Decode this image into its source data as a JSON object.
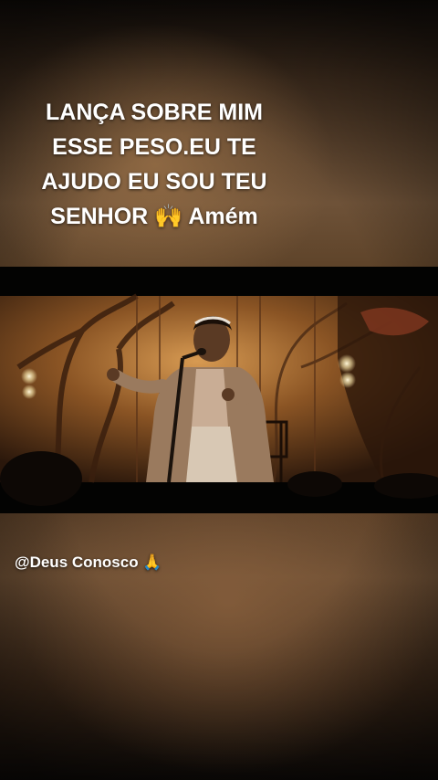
{
  "overlay": {
    "caption_line1": "LANÇA SOBRE MIM",
    "caption_line2": "ESSE PESO.EU TE",
    "caption_line3": "AJUDO EU SOU TEU",
    "caption_line4": "SENHOR 🙌 Amém"
  },
  "video": {
    "description_icon": "video-frame"
  },
  "watermark": {
    "text": "@Deus Conosco 🙏"
  }
}
